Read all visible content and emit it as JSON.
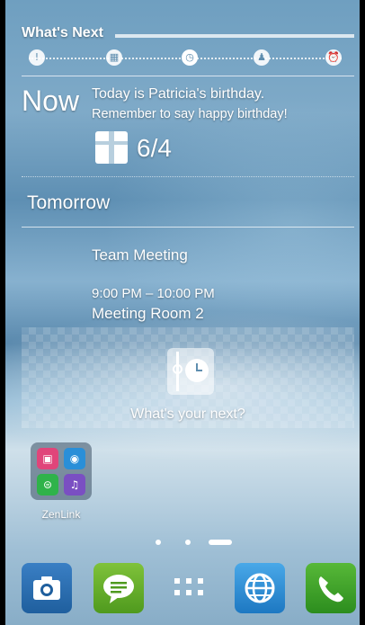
{
  "widget": {
    "title": "What's Next",
    "timeline_icons": [
      "exclamation-icon",
      "gift-icon",
      "clock-icon",
      "people-icon",
      "alarm-icon"
    ],
    "now": {
      "label": "Now",
      "line1": "Today is Patricia's birthday.",
      "line2": "Remember to say happy birthday!",
      "date": "6/4"
    },
    "tomorrow": {
      "label": "Tomorrow",
      "event_title": "Team Meeting",
      "event_time": "9:00 PM – 10:00 PM",
      "event_location": "Meeting Room 2"
    },
    "next_prompt": "What's your next?"
  },
  "folder": {
    "label": "ZenLink",
    "apps": [
      "share-link-icon",
      "remote-link-icon",
      "pc-link-icon",
      "party-link-icon"
    ]
  },
  "pager": {
    "pages": 3,
    "current": 3
  },
  "dock": [
    "camera-icon",
    "messaging-icon",
    "all-apps-icon",
    "browser-icon",
    "phone-icon"
  ],
  "colors": {
    "camera": "#2a6fb4",
    "messaging": "#5faa28",
    "browser": "#2d8ad6",
    "phone": "#3aa028"
  }
}
